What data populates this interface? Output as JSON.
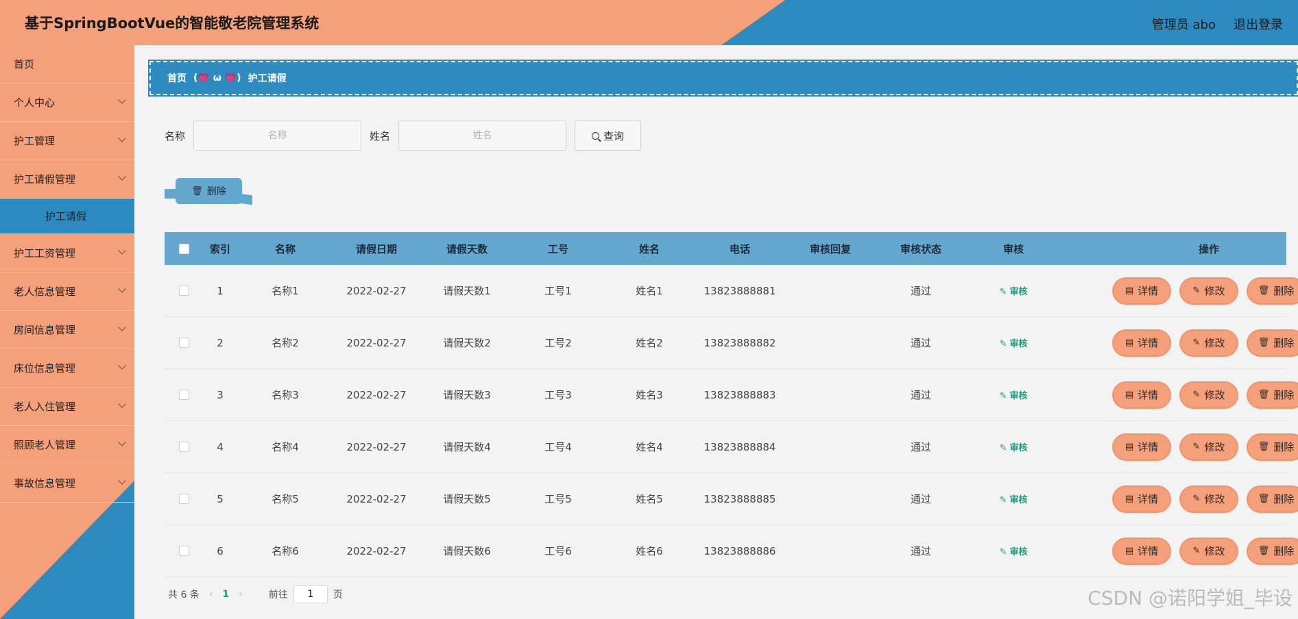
{
  "header": {
    "title": "基于SpringBootVue的智能敬老院管理系统",
    "user": "管理员 abo",
    "logout": "退出登录"
  },
  "sidebar": {
    "items": [
      {
        "label": "首页",
        "expandable": false
      },
      {
        "label": "个人中心",
        "expandable": true
      },
      {
        "label": "护工管理",
        "expandable": true
      },
      {
        "label": "护工请假管理",
        "expandable": true
      },
      {
        "label": "护工请假",
        "expandable": false,
        "active": true
      },
      {
        "label": "护工工资管理",
        "expandable": true
      },
      {
        "label": "老人信息管理",
        "expandable": true
      },
      {
        "label": "房间信息管理",
        "expandable": true
      },
      {
        "label": "床位信息管理",
        "expandable": true
      },
      {
        "label": "老人入住管理",
        "expandable": true
      },
      {
        "label": "照顾老人管理",
        "expandable": true
      },
      {
        "label": "事故信息管理",
        "expandable": true
      }
    ]
  },
  "breadcrumb": {
    "home": "首页",
    "separator": "(💗 ω 💗)",
    "current": "护工请假"
  },
  "search": {
    "name_label": "名称",
    "name_placeholder": "名称",
    "person_label": "姓名",
    "person_placeholder": "姓名",
    "button": "查询"
  },
  "toolbar": {
    "delete_label": "删除"
  },
  "table": {
    "headers": [
      "索引",
      "名称",
      "请假日期",
      "请假天数",
      "工号",
      "姓名",
      "电话",
      "审核回复",
      "审核状态",
      "审核",
      "操作"
    ],
    "audit_label": "审核",
    "actions": {
      "detail": "详情",
      "edit": "修改",
      "delete": "删除"
    },
    "rows": [
      {
        "index": "1",
        "name": "名称1",
        "date": "2022-02-27",
        "days": "请假天数1",
        "job_no": "工号1",
        "person": "姓名1",
        "phone": "13823888881",
        "reply": "",
        "status": "通过"
      },
      {
        "index": "2",
        "name": "名称2",
        "date": "2022-02-27",
        "days": "请假天数2",
        "job_no": "工号2",
        "person": "姓名2",
        "phone": "13823888882",
        "reply": "",
        "status": "通过"
      },
      {
        "index": "3",
        "name": "名称3",
        "date": "2022-02-27",
        "days": "请假天数3",
        "job_no": "工号3",
        "person": "姓名3",
        "phone": "13823888883",
        "reply": "",
        "status": "通过"
      },
      {
        "index": "4",
        "name": "名称4",
        "date": "2022-02-27",
        "days": "请假天数4",
        "job_no": "工号4",
        "person": "姓名4",
        "phone": "13823888884",
        "reply": "",
        "status": "通过"
      },
      {
        "index": "5",
        "name": "名称5",
        "date": "2022-02-27",
        "days": "请假天数5",
        "job_no": "工号5",
        "person": "姓名5",
        "phone": "13823888885",
        "reply": "",
        "status": "通过"
      },
      {
        "index": "6",
        "name": "名称6",
        "date": "2022-02-27",
        "days": "请假天数6",
        "job_no": "工号6",
        "person": "姓名6",
        "phone": "13823888886",
        "reply": "",
        "status": "通过"
      }
    ]
  },
  "pagination": {
    "total": "共 6 条",
    "current_page": "1",
    "goto_label": "前往",
    "goto_value": "1",
    "page_suffix": "页"
  },
  "watermark": "CSDN @诺阳学姐_毕设",
  "colors": {
    "orange": "#f4a07a",
    "blue": "#2e8bc0",
    "table_header": "#64a8cf",
    "audit_green": "#1a9c7e"
  }
}
